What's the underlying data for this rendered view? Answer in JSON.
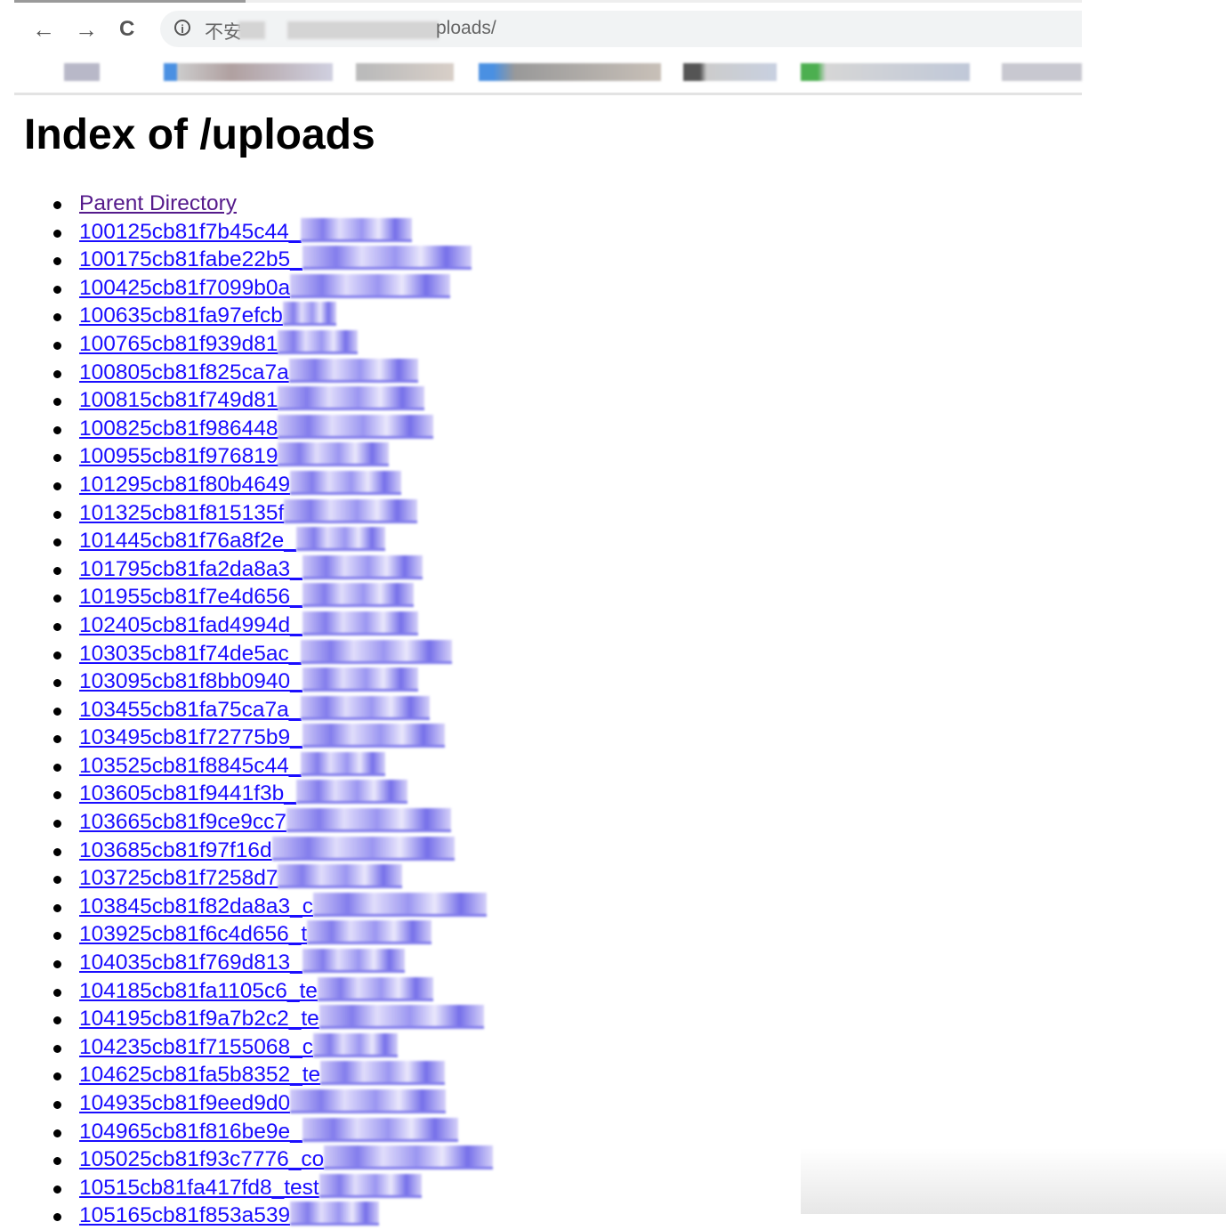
{
  "browser": {
    "url_prefix": "不安",
    "url_suffix": "ploads/",
    "icons": [
      "back-arrow-icon",
      "forward-arrow-icon",
      "reload-icon",
      "info-icon"
    ],
    "back": "←",
    "forward": "→",
    "reload": "C",
    "info": "i"
  },
  "page": {
    "title": "Index of /uploads",
    "parent": "Parent Directory",
    "link_color": "#1a0dff",
    "visited_color": "#551a8b",
    "files": [
      "100125cb81f7b45c44_",
      "100175cb81fabe22b5_",
      "100425cb81f7099b0a",
      "100635cb81fa97efcb",
      "100765cb81f939d81",
      "100805cb81f825ca7a",
      "100815cb81f749d81",
      "100825cb81f986448",
      "100955cb81f976819",
      "101295cb81f80b4649",
      "101325cb81f815135f",
      "101445cb81f76a8f2e_",
      "101795cb81fa2da8a3_",
      "101955cb81f7e4d656_",
      "102405cb81fad4994d_",
      "103035cb81f74de5ac_",
      "103095cb81f8bb0940_",
      "103455cb81fa75ca7a_",
      "103495cb81f72775b9_",
      "103525cb81f8845c44_",
      "103605cb81f9441f3b_",
      "103665cb81f9ce9cc7",
      "103685cb81f97f16d",
      "103725cb81f7258d7",
      "103845cb81f82da8a3_c",
      "103925cb81f6c4d656_t",
      "104035cb81f769d813_",
      "104185cb81fa1105c6_te",
      "104195cb81f9a7b2c2_te",
      "104235cb81f7155068_c",
      "104625cb81fa5b8352_te",
      "104935cb81f9eed9d0",
      "104965cb81f816be9e_",
      "105025cb81f93c7776_co",
      "10515cb81fa417fd8_test",
      "105165cb81f853a539"
    ]
  }
}
